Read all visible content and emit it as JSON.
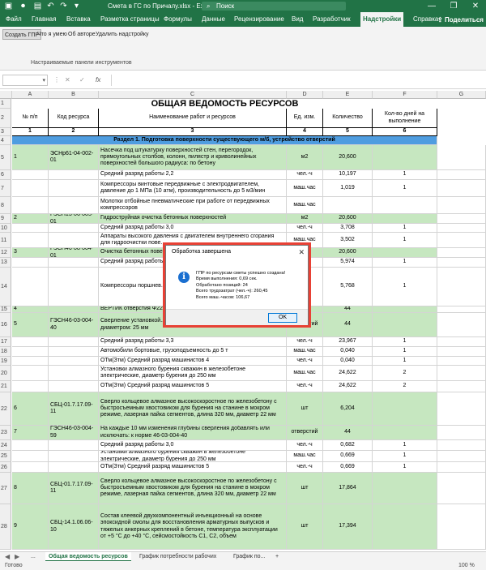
{
  "window": {
    "title": "Смета в ГС по Причалу.xlsx  -  Excel",
    "search_label": "Поиск",
    "controls": [
      "—",
      "❐",
      "✕"
    ]
  },
  "ribbon_tabs": [
    "Файл",
    "Главная",
    "Вставка",
    "Разметка страницы",
    "Формулы",
    "Данные",
    "Рецензирование",
    "Вид",
    "Разработчик",
    "Надстройки",
    "Справка"
  ],
  "active_tab": "Надстройки",
  "share_label": "Поделиться",
  "ribbon": {
    "buttons": [
      "Создать ГПР",
      "Что я умею",
      "Об авторе",
      "Удалить надстройку"
    ],
    "group_label": "Настраиваемые панели инструментов"
  },
  "formula_bar": {
    "fx": "fx",
    "cancel": "✕",
    "enter": "✓",
    "value": ""
  },
  "columns": [
    "A",
    "B",
    "C",
    "D",
    "E",
    "F",
    "G"
  ],
  "sheet": {
    "title": "ОБЩАЯ ВЕДОМОСТЬ РЕСУРСОВ",
    "headers": [
      "№ п/п",
      "Код ресурса",
      "Наименование работ и ресурсов",
      "Ед. изм.",
      "Количество",
      "Кол-во дней на выполнение"
    ],
    "header_nums": [
      "1",
      "2",
      "3",
      "4",
      "5",
      "6"
    ],
    "section": "Раздел 1. Подготовка поверхности существующего м/б, устройство отверстий",
    "rows": [
      {
        "r": "5",
        "a": "1",
        "b": "ЭСНр61-04-002-01",
        "c": "Насечка под штукатурку поверхностей стен, перегородок, прямоугольных столбов, колонн, пилястр и криволинейных поверхностей большого радиуса: по бетону",
        "d": "м2",
        "e": "20,600",
        "f": "",
        "g": true
      },
      {
        "r": "6",
        "a": "",
        "b": "",
        "c": "Средний разряд работы 2,2",
        "d": "чел.-ч",
        "e": "10,197",
        "f": "1",
        "g": false
      },
      {
        "r": "7",
        "a": "",
        "b": "",
        "c": "Компрессоры винтовые передвижные с электродвигателем, давление до 1 МПа (10 атм), производительность до 5 м3/мин",
        "d": "маш.час",
        "e": "1,019",
        "f": "1",
        "g": false
      },
      {
        "r": "8",
        "a": "",
        "b": "",
        "c": "Молотки отбойные пневматические при работе от передвижных компрессоров",
        "d": "маш.час",
        "e": "",
        "f": "",
        "g": false
      },
      {
        "r": "9",
        "a": "2",
        "b": "ГЭСН13-06-005-01",
        "c": "Гидроструйная очистка бетонных поверхностей",
        "d": "м2",
        "e": "20,600",
        "f": "",
        "g": true
      },
      {
        "r": "10",
        "a": "",
        "b": "",
        "c": "Средний разряд работы 3,0",
        "d": "чел.-ч",
        "e": "3,708",
        "f": "1",
        "g": false
      },
      {
        "r": "11",
        "a": "",
        "b": "",
        "c": "Аппараты высокого давления с двигателем внутреннего сгорания для гидроочистки пове...",
        "d": "маш.час",
        "e": "3,502",
        "f": "1",
        "g": false
      },
      {
        "r": "12",
        "a": "3",
        "b": "ГЭСН46-08-004-01",
        "c": "Очистка бетонных пове...",
        "d": "",
        "e": "20,600",
        "f": "",
        "g": true
      },
      {
        "r": "13",
        "a": "",
        "b": "",
        "c": "Средний разряд работы...",
        "d": "",
        "e": "5,974",
        "f": "1",
        "g": false
      },
      {
        "r": "14",
        "a": "",
        "b": "",
        "c": "Компрессоры поршнев... давление до 0,6 МПа (6 ...",
        "d": "",
        "e": "5,768",
        "f": "1",
        "g": false
      },
      {
        "r": "15",
        "a": "4",
        "b": "",
        "c": "ВЕРТИК отверстия Ф22 ...",
        "d": "",
        "e": "44",
        "f": "",
        "g": true
      },
      {
        "r": "16",
        "a": "5",
        "b": "ГЭСН46-03-004-40",
        "c": "Сверление установкой... отверстий в густоарм... глубиной 200 мм диаметром: 25 мм",
        "d": "отверстий",
        "e": "44",
        "f": "",
        "g": true
      },
      {
        "r": "17",
        "a": "",
        "b": "",
        "c": "Средний разряд работы 3,3",
        "d": "чел.-ч",
        "e": "23,967",
        "f": "1",
        "g": false
      },
      {
        "r": "18",
        "a": "",
        "b": "",
        "c": "Автомобили бортовые, грузоподъемность до 5 т",
        "d": "маш.час",
        "e": "0,040",
        "f": "1",
        "g": false
      },
      {
        "r": "19",
        "a": "",
        "b": "",
        "c": "ОТм(Зтм) Средний разряд машинистов 4",
        "d": "чел.-ч",
        "e": "0,040",
        "f": "1",
        "g": false
      },
      {
        "r": "20",
        "a": "",
        "b": "",
        "c": "Установки алмазного бурения скважин в железобетоне электрические, диаметр бурения до 250 мм",
        "d": "маш.час",
        "e": "24,622",
        "f": "2",
        "g": false
      },
      {
        "r": "21",
        "a": "",
        "b": "",
        "c": "ОТм(Зтм) Средний разряд машинистов 5",
        "d": "чел.-ч",
        "e": "24,622",
        "f": "2",
        "g": false
      },
      {
        "r": "22",
        "a": "6",
        "b": "СБЦ-01.7.17.09-11",
        "c": "Сверло кольцевое алмазное высокоскоростное по железобетону с быстросъемным хвостовиком для бурения на станине в мокром режиме, лазерная пайка сегментов, длина 320 мм, диаметр 22 мм",
        "d": "шт",
        "e": "6,204",
        "f": "",
        "g": true
      },
      {
        "r": "23",
        "a": "7",
        "b": "ГЭСН46-03-004-59",
        "c": "На каждые 10 мм изменения глубины сверления добавлять или исключать: к норме 46-03-004-40",
        "d": "отверстий",
        "e": "44",
        "f": "",
        "g": true
      },
      {
        "r": "24",
        "a": "",
        "b": "",
        "c": "Средний разряд работы 3,0",
        "d": "чел.-ч",
        "e": "0,682",
        "f": "1",
        "g": false
      },
      {
        "r": "25",
        "a": "",
        "b": "",
        "c": "Установки алмазного бурения скважин в железобетоне электрические, диаметр бурения до 250 мм",
        "d": "маш.час",
        "e": "0,669",
        "f": "1",
        "g": false
      },
      {
        "r": "26",
        "a": "",
        "b": "",
        "c": "ОТм(Зтм) Средний разряд машинистов 5",
        "d": "чел.-ч",
        "e": "0,669",
        "f": "1",
        "g": false
      },
      {
        "r": "27",
        "a": "8",
        "b": "СБЦ-01.7.17.09-11",
        "c": "Сверло кольцевое алмазное высокоскоростное по железобетону с быстросъемным хвостовиком для бурения на станине в мокром режиме, лазерная пайка сегментов, длина 320 мм, диаметр 22 мм",
        "d": "шт",
        "e": "17,864",
        "f": "",
        "g": true
      },
      {
        "r": "28",
        "a": "9",
        "b": "СБЦ-14.1.06.06-10",
        "c": "Состав клеевой двухкомпонентный инъекционный на основе эпоксидной смолы для восстановления арматурных выпусков и тяжелых анкерных креплений в бетоне, температура эксплуатации от +5 °С до +40 °С, сейсмостойкость С1, С2, объем",
        "d": "шт",
        "e": "17,394",
        "f": "",
        "g": true
      }
    ]
  },
  "sheet_tabs": [
    "...",
    "Общая ведомость ресурсов",
    "График потребности рабочих",
    "График по..."
  ],
  "sheet_add": "+",
  "status": {
    "left": "Готово",
    "zoom": "100 %"
  },
  "dialog": {
    "title": "Обработка завершена",
    "close": "✕",
    "icon": "i",
    "lines": [
      "ГПР по ресурсам сметы успешно создана!",
      "Время выполнения: 0,69 сек.",
      "Обработано позиций: 24",
      "Всего трудозатрат (чел.-ч): 260,45",
      "Всего маш.-часов: 106,67"
    ],
    "ok": "OK"
  },
  "colors": {
    "excel_green": "#217346",
    "row_green": "#c6e7c0",
    "section_blue": "#4f9de0",
    "dialog_border": "#e84135"
  }
}
